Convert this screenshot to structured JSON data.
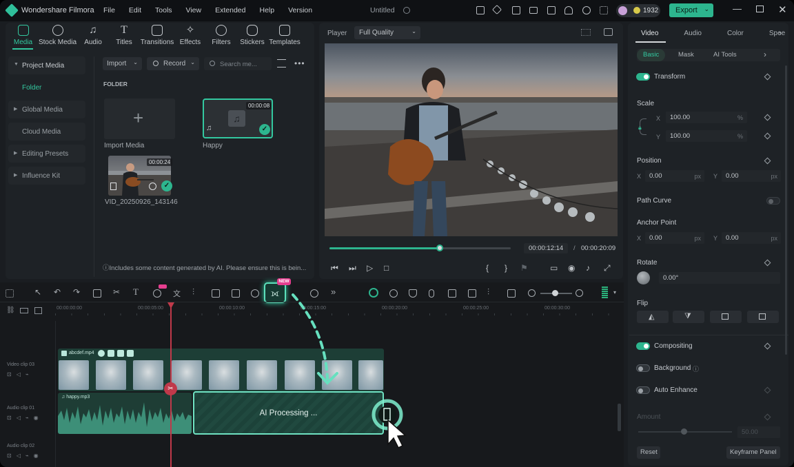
{
  "app": {
    "name": "Wondershare Filmora",
    "window_title": "Untitled"
  },
  "menu": [
    "File",
    "Edit",
    "Tools",
    "View",
    "Extended",
    "Help",
    "Version"
  ],
  "account": {
    "credits": "1932"
  },
  "export": {
    "label": "Export"
  },
  "media_tabs": [
    "Media",
    "Stock Media",
    "Audio",
    "Titles",
    "Transitions",
    "Effects",
    "Filters",
    "Stickers",
    "Templates"
  ],
  "sidebar": [
    {
      "label": "Project Media"
    },
    {
      "label": "Folder"
    },
    {
      "label": "Global Media"
    },
    {
      "label": "Cloud Media"
    },
    {
      "label": "Editing Presets"
    },
    {
      "label": "Influence Kit"
    }
  ],
  "media_toolbar": {
    "import": "Import",
    "record": "Record",
    "search_placeholder": "Search me..."
  },
  "folder_label": "FOLDER",
  "media_items": [
    {
      "label": "Import Media"
    },
    {
      "label": "Happy",
      "duration": "00:00:08"
    },
    {
      "label": "VID_20250926_143146",
      "duration": "00:00:24"
    }
  ],
  "notice": "Includes some content generated by AI. Please ensure this is bein...",
  "player": {
    "label": "Player",
    "quality": "Full Quality",
    "current": "00:00:12:14",
    "separator": "/",
    "total": "00:00:20:09",
    "progress": 0.61
  },
  "properties": {
    "tabs": [
      "Video",
      "Audio",
      "Color",
      "Spee"
    ],
    "subtabs": [
      "Basic",
      "Mask",
      "AI Tools"
    ],
    "transform": "Transform",
    "scale": "Scale",
    "scale_x": "100.00",
    "scale_y": "100.00",
    "scale_unit": "%",
    "position": "Position",
    "pos_x": "0.00",
    "pos_y": "0.00",
    "px": "px",
    "path_curve": "Path Curve",
    "anchor": "Anchor Point",
    "anchor_x": "0.00",
    "anchor_y": "0.00",
    "rotate": "Rotate",
    "rotate_val": "0.00°",
    "flip": "Flip",
    "compositing": "Compositing",
    "background": "Background",
    "auto_enhance": "Auto Enhance",
    "amount": "Amount",
    "amount_val": "50.00",
    "x": "X",
    "y": "Y",
    "reset": "Reset",
    "keyframe_panel": "Keyframe Panel"
  },
  "timeline": {
    "ruler": [
      "00:00:00:00",
      "00:00:05:00",
      "00:00:10:00",
      "00:00:15:00",
      "00:00:20:00",
      "00:00:25:00",
      "00:00:30:00"
    ],
    "tracks": [
      "Video clip 03",
      "Audio clip 01",
      "Audio clip 02"
    ],
    "video_clip_name": "abcdef.mp4",
    "audio_clip_name": "happy.mp3",
    "ai_processing": "AI Processing ...",
    "new_badge": "NEW"
  }
}
